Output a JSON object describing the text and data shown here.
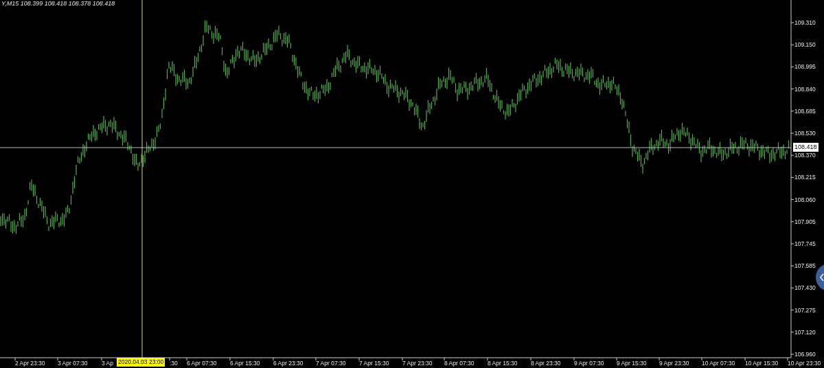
{
  "chart_header": "Y,M15 108.399 108.418 108.378 108.418",
  "price_axis": {
    "labels": [
      "109.310",
      "109.150",
      "108.995",
      "108.840",
      "108.685",
      "108.530",
      "108.370",
      "108.215",
      "108.060",
      "107.905",
      "107.745",
      "107.585",
      "107.430",
      "107.275",
      "107.120",
      "106.960"
    ],
    "current_price": "108.418"
  },
  "time_axis": {
    "labels": [
      "2 Apr 23:30",
      "3 Apr 07:30",
      "3 Ap",
      ":30",
      "6 Apr 07:30",
      "6 Apr 15:30",
      "6 Apr 23:30",
      "7 Apr 07:30",
      "7 Apr 15:30",
      "7 Apr 23:30",
      "8 Apr 07:30",
      "8 Apr 15:30",
      "8 Apr 23:30",
      "9 Apr 07:30",
      "9 Apr 15:30",
      "9 Apr 23:30",
      "10 Apr 07:30",
      "10 Apr 15:30",
      "10 Apr 23:30"
    ],
    "crosshair_time": "2020.04.03 23:00"
  }
}
